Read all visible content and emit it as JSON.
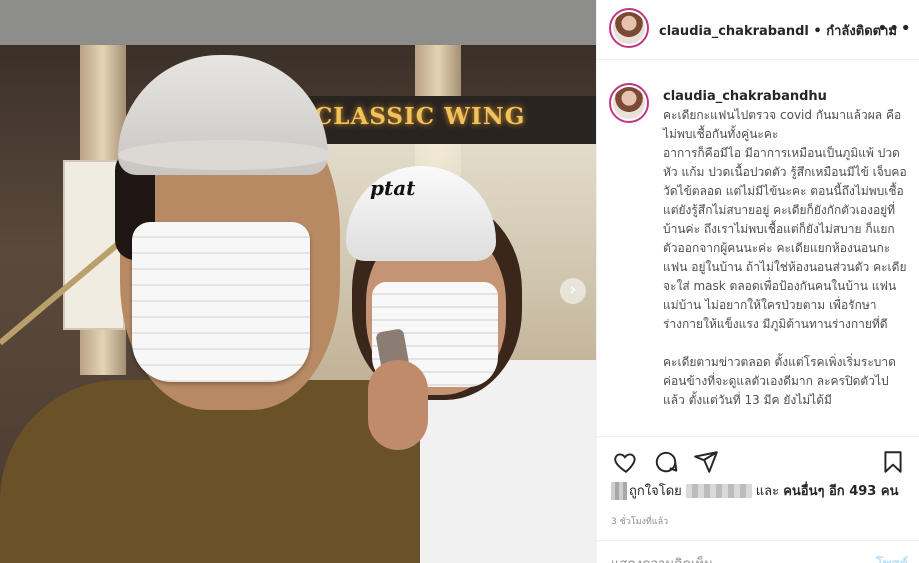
{
  "photo": {
    "sign_text": "CLASSIC WING",
    "cap_logo": "ptat",
    "next_label": "›"
  },
  "header": {
    "username": "claudia_chakrabandl",
    "separator": "•",
    "follow_status": "กำลังติดตาม",
    "more_label": "•••"
  },
  "caption": {
    "username": "claudia_chakrabandhu",
    "body": "คะเดียกะแฟนไปตรวจ covid กันมาแล้วผล คือไม่พบเชื้อกันทั้งคู่นะคะ\nอาการก็คือมีไอ มีอาการเหมือนเป็นภูมิแพ้ ปวดหัว แก้ม ปวดเนื้อปวดตัว รู้สึกเหมือนมีไข้ เจ็บคอ วัดไข้ตลอด แต่ไม่มีไข้นะคะ ตอนนี้ถึงไม่พบเชื้อแต่ยังรู้สึกไม่สบายอยู่ คะเดียก็ยังกักตัวเองอยู่ที่บ้านค่ะ ถึงเราไม่พบเชื้อแต่ก็ยังไม่สบาย ก็แยกตัวออกจากผู้คนนะค่ะ คะเดียแยกห้องนอนกะแฟน อยู่ในบ้าน ถ้าไม่ใช่ห้องนอนส่วนตัว คะเดียจะใส่ mask ตลอดเพื่อป้องกันคนในบ้าน แฟนแม่บ้าน ไม่อยากให้ใครป่วยตาม เพื่อรักษาร่างกายให้แข็งแรง มีภูมิต้านทานร่างกายที่ดี\n\nคะเดียตามข่าวตลอด ตั้งแต่โรคเพิ่งเริ่มระบาด ค่อนข้างที่จะดูแลตัวเองดีมาก ละครปิดตัวไปแล้ว ตั้งแต่วันที่ 13 มีค ยังไม่ได้มี"
  },
  "likes": {
    "prefix": "ถูกใจโดย",
    "middle": "และ",
    "others": "คนอื่นๆ อีก 493 คน"
  },
  "time": "3 ชั่วโมงที่แล้ว",
  "comment_box": {
    "placeholder": "แสดงความคิดเห็น...",
    "post_label": "โพสต์"
  }
}
